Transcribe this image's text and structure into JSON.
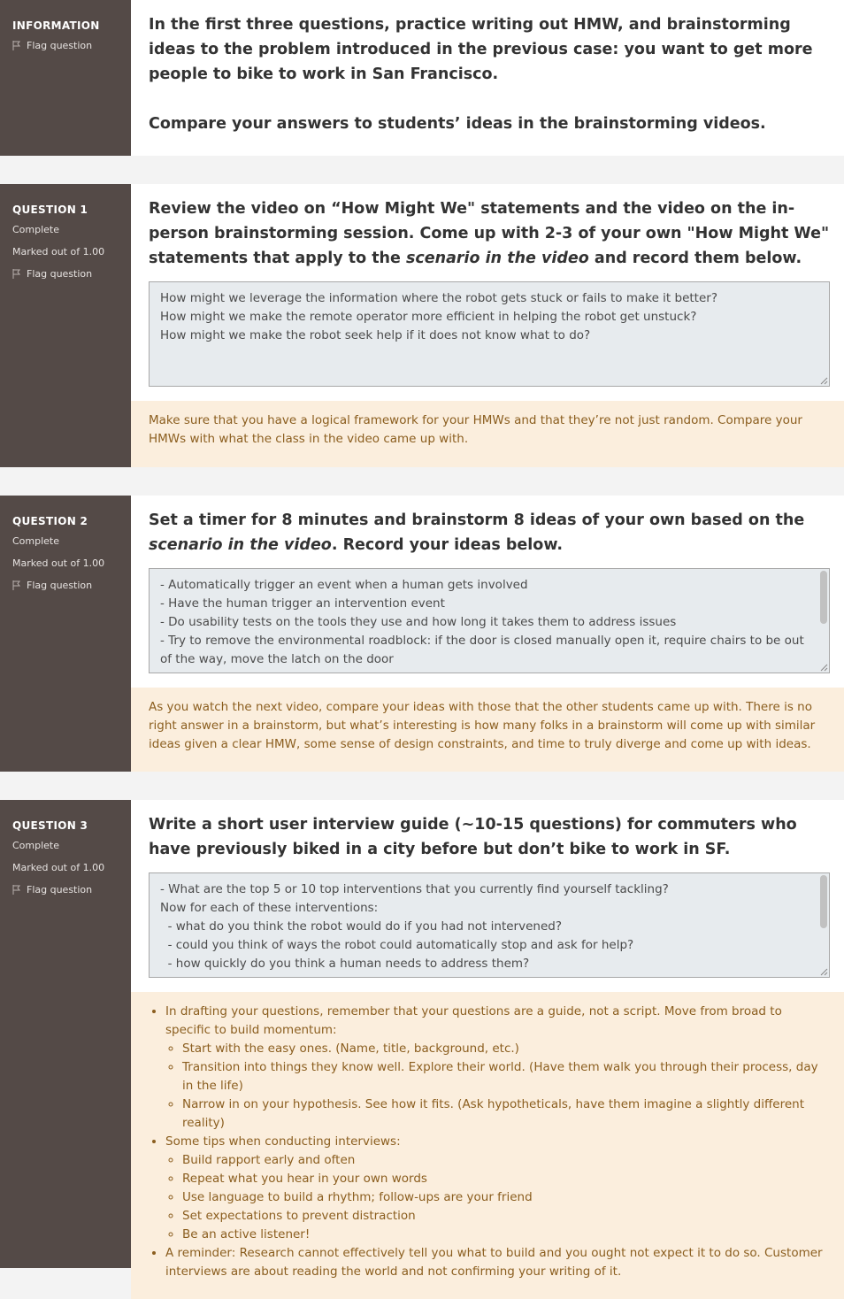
{
  "info": {
    "kind": "INFORMATION",
    "flag_label": "Flag question",
    "paragraph1": "In the first three questions, practice writing out HMW, and brainstorming ideas to the problem introduced in the previous case: you want to get more people to bike to work in San Francisco.",
    "paragraph2": "Compare your answers to students’ ideas in the brainstorming videos."
  },
  "q1": {
    "kind": "QUESTION 1",
    "status": "Complete",
    "marks": "Marked out of 1.00",
    "flag_label": "Flag question",
    "text_before": "Review the video on “How Might We\" statements and the video on the in-person brainstorming session. Come up with 2-3 of your own \"How Might We\" statements that apply to the ",
    "text_em": "scenario in the video",
    "text_after": " and record them below.",
    "answer_lines": [
      "How might we leverage the information where the robot gets stuck or fails to make it better?",
      "How might we make the remote operator more efficient in helping the robot get unstuck?",
      "How might we make the robot seek help if it does not know what to do?"
    ],
    "feedback": "Make sure that you have a logical framework for your HMWs and that they’re not just random. Compare your HMWs with what the class in the video came up with."
  },
  "q2": {
    "kind": "QUESTION 2",
    "status": "Complete",
    "marks": "Marked out of 1.00",
    "flag_label": "Flag question",
    "text_before": "Set a timer for 8 minutes and brainstorm 8 ideas of your own based on the ",
    "text_em": "scenario in the video",
    "text_after": ". Record your ideas below.",
    "answer_lines": [
      "- Automatically trigger an event when a human gets involved",
      "- Have the human trigger an intervention event",
      "- Do usability tests on the tools they use and how long it takes them to address issues",
      "- Try to remove the environmental roadblock: if the door is closed manually open it, require chairs to be out of the way, move the latch on the door"
    ],
    "feedback": "As you watch the next video, compare your ideas with those that the other students came up with. There is no right answer in a brainstorm, but what’s interesting is how many folks in a brainstorm will come up with similar ideas given a clear HMW, some sense of design constraints, and time to truly diverge and come up with ideas."
  },
  "q3": {
    "kind": "QUESTION 3",
    "status": "Complete",
    "marks": "Marked out of 1.00",
    "flag_label": "Flag question",
    "text": "Write a short user interview guide (~10-15 questions) for commuters who have previously biked in a city before but don’t bike to work in SF.",
    "answer_lines": [
      "- What are the top 5 or 10 top interventions that you currently find yourself tackling?",
      "Now for each of these interventions:",
      "  - what do you think the robot would do if you had not intervened?",
      "  - could you think of ways the robot could automatically stop and ask for help?",
      "  - how quickly do you think a human needs to address them?"
    ],
    "feedback": {
      "b1": "In drafting your questions, remember that your questions are a guide, not a script. Move from broad to specific to build momentum:",
      "b1_subs": [
        "Start with the easy ones. (Name, title, background, etc.)",
        "Transition into things they know well. Explore their world. (Have them walk you through their process, day in the life)",
        "Narrow in on your hypothesis. See how it fits. (Ask hypotheticals, have them imagine a slightly different reality)"
      ],
      "b2": "Some tips when conducting interviews:",
      "b2_subs": [
        "Build rapport early and often",
        "Repeat what you hear in your own words",
        "Use language to build a rhythm; follow-ups are your friend",
        "Set expectations to prevent distraction",
        "Be an active listener!"
      ],
      "b3": "A reminder: Research cannot effectively tell you what to build and you ought not expect it to do so. Customer interviews are about reading the world and not confirming your writing of it."
    }
  }
}
